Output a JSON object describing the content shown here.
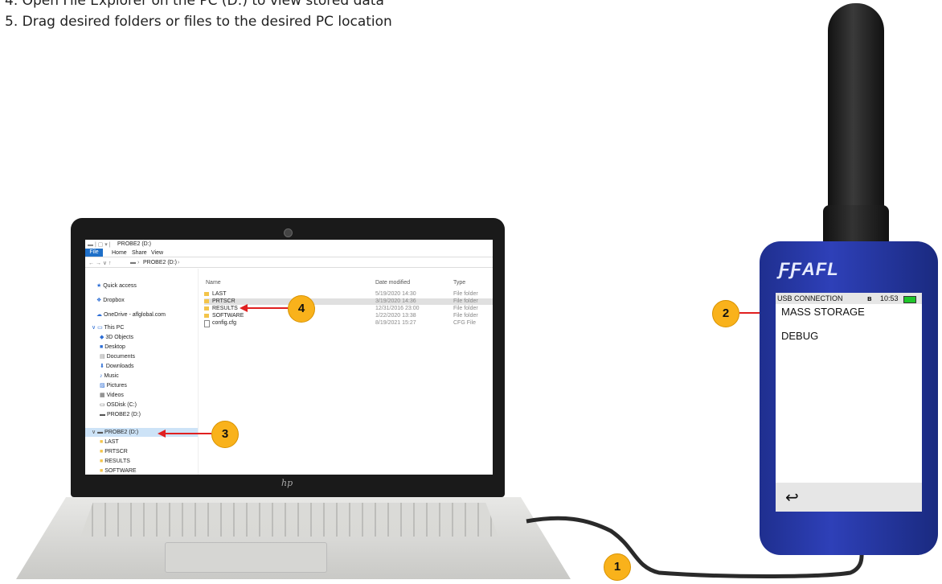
{
  "instructions": {
    "step4_partial": "4.  Open File Explorer on the PC (D:) to view stored data",
    "step5": "5.  Drag desired folders or files to the desired PC location"
  },
  "laptop": {
    "brand": "hp",
    "explorer": {
      "title": "PROBE2 (D:)",
      "ribbon_tabs": [
        "File",
        "Home",
        "Share",
        "View"
      ],
      "address": "PROBE2 (D:)",
      "nav": {
        "quick_access": "Quick access",
        "dropbox": "Dropbox",
        "onedrive": "OneDrive - aflglobal.com",
        "this_pc": "This PC",
        "objects3d": "3D Objects",
        "desktop": "Desktop",
        "documents": "Documents",
        "downloads": "Downloads",
        "music": "Music",
        "pictures": "Pictures",
        "videos": "Videos",
        "osdisk": "OSDisk (C:)",
        "probe2": "PROBE2 (D:)",
        "probe2_selected": "PROBE2 (D:)",
        "sub_last": "LAST",
        "sub_prtscr": "PRTSCR",
        "sub_results": "RESULTS",
        "sub_software": "SOFTWARE"
      },
      "columns": {
        "name": "Name",
        "date": "Date modified",
        "type": "Type"
      },
      "files": [
        {
          "name": "LAST",
          "date": "5/19/2020 14:30",
          "type": "File folder"
        },
        {
          "name": "PRTSCR",
          "date": "3/19/2020 14:36",
          "type": "File folder"
        },
        {
          "name": "RESULTS",
          "date": "12/31/2016 23:00",
          "type": "File folder"
        },
        {
          "name": "SOFTWARE",
          "date": "1/22/2020 13:38",
          "type": "File folder"
        },
        {
          "name": "config.cfg",
          "date": "8/19/2021 15:27",
          "type": "CFG File"
        }
      ]
    }
  },
  "device": {
    "logo": "AFL",
    "status": {
      "title": "USB CONNECTION",
      "time": "10:53"
    },
    "menu": [
      "MASS STORAGE",
      "DEBUG"
    ],
    "back_glyph": "↩"
  },
  "callouts": {
    "c1": "1",
    "c2": "2",
    "c3": "3",
    "c4": "4"
  },
  "colors": {
    "callout": "#f9b21b",
    "arrow": "#e02020",
    "device_body": "#2e40b8",
    "battery": "#1fc62a"
  }
}
